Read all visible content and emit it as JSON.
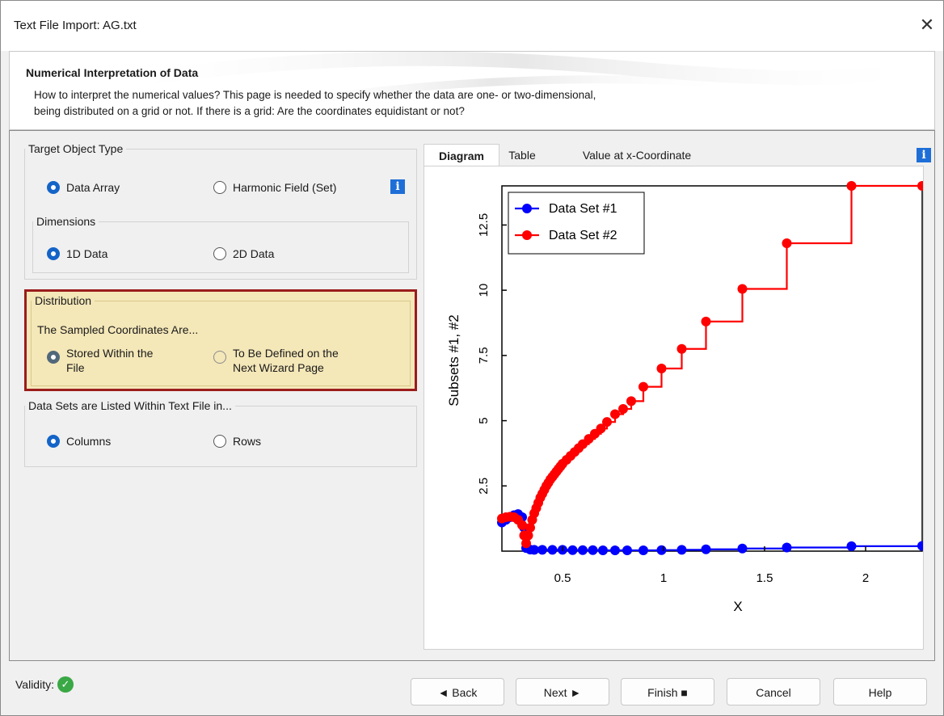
{
  "window": {
    "title": "Text File Import: AG.txt",
    "close_label": "✕"
  },
  "header": {
    "title": "Numerical Interpretation of Data",
    "description_line1": "How to interpret the numerical values? This page is needed to specify whether the data are one- or two-dimensional,",
    "description_line2": "being distributed on a grid or not. If there is a grid: Are the coordinates equidistant or not?"
  },
  "target_object_type": {
    "legend": "Target Object Type",
    "options": [
      {
        "label": "Data Array",
        "checked": true
      },
      {
        "label": "Harmonic Field (Set)",
        "checked": false
      }
    ],
    "info_icon": "i"
  },
  "dimensions": {
    "legend": "Dimensions",
    "options": [
      {
        "label": "1D Data",
        "checked": true
      },
      {
        "label": "2D Data",
        "checked": false
      }
    ]
  },
  "distribution": {
    "legend": "Distribution",
    "subtitle": "The Sampled Coordinates Are...",
    "options": [
      {
        "label_line1": "Stored Within the",
        "label_line2": "File",
        "checked": true
      },
      {
        "label_line1": "To Be Defined on the",
        "label_line2": "Next Wizard Page",
        "checked": false
      }
    ],
    "highlight_color": "#f4e7b8",
    "border_color": "#9b1c1c"
  },
  "data_sets_listing": {
    "legend": "Data Sets are Listed Within Text File in...",
    "options": [
      {
        "label": "Columns",
        "checked": true
      },
      {
        "label": "Rows",
        "checked": false
      }
    ]
  },
  "tabs": [
    {
      "label": "Diagram",
      "active": true
    },
    {
      "label": "Table",
      "active": false
    },
    {
      "label": "Value at x-Coordinate",
      "active": false
    }
  ],
  "tabs_info_icon": "i",
  "chart_data": {
    "type": "line",
    "xlabel": "X",
    "ylabel": "Subsets #1, #2",
    "xlim": [
      0.2,
      2.28
    ],
    "ylim": [
      0,
      14
    ],
    "x_ticks": [
      "0.5",
      "1",
      "1.5",
      "2"
    ],
    "y_ticks": [
      "2.5",
      "5",
      "7.5",
      "10",
      "12.5"
    ],
    "legend_position": "top-left",
    "series": [
      {
        "name": "Data Set #1",
        "color": "#0000ff",
        "x": [
          0.2,
          0.22,
          0.24,
          0.26,
          0.28,
          0.3,
          0.31,
          0.32,
          0.34,
          0.36,
          0.4,
          0.45,
          0.5,
          0.55,
          0.6,
          0.65,
          0.7,
          0.76,
          0.82,
          0.9,
          0.99,
          1.09,
          1.21,
          1.39,
          1.61,
          1.93,
          2.28
        ],
        "y": [
          1.1,
          1.2,
          1.3,
          1.38,
          1.42,
          1.3,
          0.9,
          0.12,
          0.06,
          0.05,
          0.05,
          0.05,
          0.05,
          0.04,
          0.04,
          0.04,
          0.03,
          0.03,
          0.03,
          0.03,
          0.04,
          0.05,
          0.07,
          0.1,
          0.14,
          0.19,
          0.2
        ]
      },
      {
        "name": "Data Set #2",
        "color": "#ff0000",
        "x": [
          0.2,
          0.22,
          0.24,
          0.26,
          0.28,
          0.3,
          0.31,
          0.32,
          0.33,
          0.34,
          0.35,
          0.36,
          0.37,
          0.38,
          0.39,
          0.4,
          0.41,
          0.42,
          0.43,
          0.44,
          0.45,
          0.46,
          0.47,
          0.48,
          0.49,
          0.5,
          0.52,
          0.54,
          0.56,
          0.58,
          0.6,
          0.63,
          0.66,
          0.69,
          0.72,
          0.76,
          0.8,
          0.84,
          0.9,
          0.99,
          1.09,
          1.21,
          1.39,
          1.61,
          1.93,
          2.28
        ],
        "y": [
          1.25,
          1.3,
          1.32,
          1.3,
          1.2,
          1.0,
          0.6,
          0.3,
          0.6,
          0.9,
          1.2,
          1.45,
          1.65,
          1.85,
          2.05,
          2.2,
          2.35,
          2.5,
          2.62,
          2.75,
          2.85,
          2.95,
          3.05,
          3.15,
          3.25,
          3.35,
          3.5,
          3.65,
          3.8,
          3.95,
          4.1,
          4.3,
          4.5,
          4.7,
          4.95,
          5.25,
          5.45,
          5.75,
          6.3,
          7.0,
          7.75,
          8.8,
          10.05,
          11.8,
          14.0,
          14.0
        ]
      }
    ]
  },
  "footer": {
    "validity_label": "Validity:",
    "validity_icon": "check-icon",
    "buttons": {
      "back": "◄ Back",
      "next": "Next ►",
      "finish": "Finish ■",
      "cancel": "Cancel",
      "help": "Help"
    }
  }
}
